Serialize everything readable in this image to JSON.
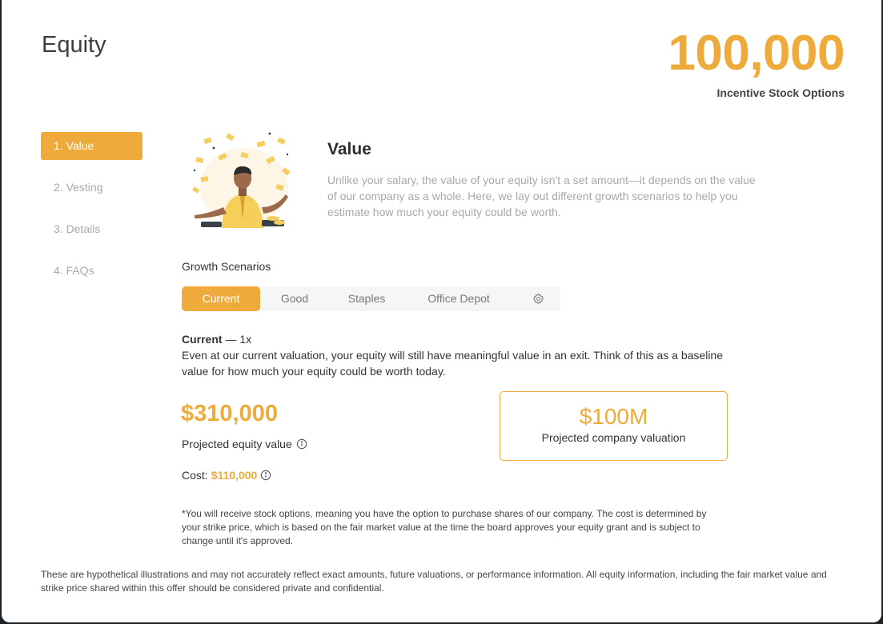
{
  "header": {
    "title": "Equity",
    "stock_count": "100,000",
    "stock_label": "Incentive Stock Options"
  },
  "nav": {
    "items": [
      {
        "label": "1. Value",
        "active": true
      },
      {
        "label": "2. Vesting",
        "active": false
      },
      {
        "label": "3. Details",
        "active": false
      },
      {
        "label": "4. FAQs",
        "active": false
      }
    ]
  },
  "section": {
    "title": "Value",
    "description": "Unlike your salary, the value of your equity isn't a set amount—it depends on the value of our company as a whole. Here, we lay out different growth scenarios to help you estimate how much your equity could be worth."
  },
  "scenarios": {
    "label": "Growth Scenarios",
    "tabs": [
      "Current",
      "Good",
      "Staples",
      "Office Depot"
    ],
    "selected": "Current",
    "gear_icon": "gear-icon"
  },
  "current": {
    "name": "Current",
    "multiplier": " — 1x",
    "description": "Even at our current valuation, your equity will still have meaningful value in an exit. Think of this as a baseline value for how much your equity could be worth today."
  },
  "equity": {
    "value": "$310,000",
    "label": "Projected equity value",
    "cost_label": "Cost:",
    "cost_value": "$110,000"
  },
  "valuation": {
    "value": "$100M",
    "label": "Projected company valuation"
  },
  "footnote": "*You will receive stock options, meaning you have the option to purchase shares of our company. The cost is determined by your strike price, which is based on the fair market value at the time the board approves your equity grant and is subject to change until it's approved.",
  "disclaimer": "These are hypothetical illustrations and may not accurately reflect exact amounts, future valuations, or performance information. All equity information, including the fair market value and strike price shared within this offer should be considered private and confidential.",
  "colors": {
    "accent": "#eeaa3b",
    "muted": "#a9a9a9",
    "background": "#1f2428"
  }
}
